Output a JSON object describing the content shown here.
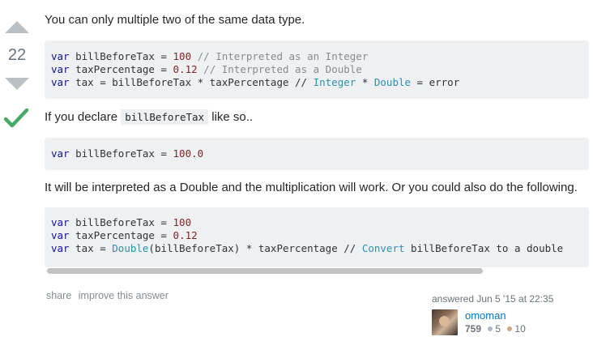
{
  "vote": {
    "count": "22"
  },
  "post": {
    "p1": "You can only multiple two of the same data type.",
    "code1": [
      [
        [
          "kw",
          "var"
        ],
        [
          "",
          "billBeforeTax = "
        ],
        [
          "num",
          "100"
        ],
        [
          "com",
          " // Interpreted as an Integer"
        ]
      ],
      [
        [
          "kw",
          "var"
        ],
        [
          "",
          "taxPercentage = "
        ],
        [
          "num",
          "0.12"
        ],
        [
          "com",
          " // Interpreted as a Double"
        ]
      ],
      [
        [
          "kw",
          "var"
        ],
        [
          "",
          "tax = billBeforeTax * taxPercentage // "
        ],
        [
          "typ",
          "Integer"
        ],
        [
          "",
          " * "
        ],
        [
          "typ",
          "Double"
        ],
        [
          "",
          " = error"
        ]
      ]
    ],
    "p2_prefix": "If you declare ",
    "p2_code": "billBeforeTax",
    "p2_suffix": " like so..",
    "code2": [
      [
        [
          "kw",
          "var"
        ],
        [
          "",
          "billBeforeTax = "
        ],
        [
          "num",
          "100.0"
        ]
      ]
    ],
    "p3": "It will be interpreted as a Double and the multiplication will work. Or you could also do the following.",
    "code3": [
      [
        [
          "kw",
          "var"
        ],
        [
          "",
          "billBeforeTax = "
        ],
        [
          "num",
          "100"
        ]
      ],
      [
        [
          "kw",
          "var"
        ],
        [
          "",
          "taxPercentage = "
        ],
        [
          "num",
          "0.12"
        ]
      ],
      [
        [
          "kw",
          "var"
        ],
        [
          "",
          "tax = "
        ],
        [
          "typ",
          "Double"
        ],
        [
          "",
          "(billBeforeTax) * taxPercentage // "
        ],
        [
          "typ",
          "Convert"
        ],
        [
          "",
          " billBeforeTax to a double"
        ]
      ]
    ]
  },
  "menu": {
    "share": "share",
    "improve": "improve this answer"
  },
  "signature": {
    "action": "answered Jun 5 '15 at 22:35",
    "user": "omoman",
    "reputation": "759",
    "silver": "5",
    "bronze": "10"
  },
  "colors": {
    "keyword": "#101094",
    "number": "#7d2727",
    "comment": "#858c93",
    "type": "#2b91af",
    "link": "#0077cc"
  }
}
